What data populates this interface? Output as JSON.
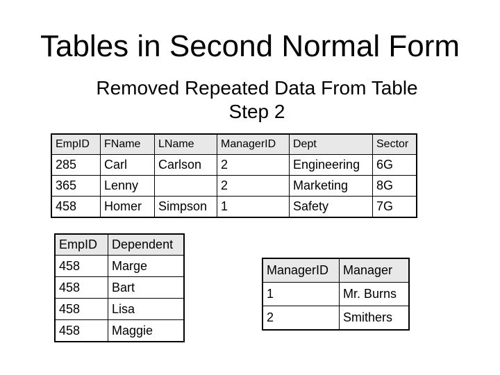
{
  "slide": {
    "title": "Tables in Second Normal Form",
    "subtitle_line1": "Removed Repeated Data From Table",
    "subtitle_line2": "Step 2"
  },
  "employee_table": {
    "headers": [
      "EmpID",
      "FName",
      "LName",
      "ManagerID",
      "Dept",
      "Sector"
    ],
    "rows": [
      [
        "285",
        "Carl",
        "Carlson",
        "2",
        "Engineering",
        "6G"
      ],
      [
        "365",
        "Lenny",
        "",
        "2",
        "Marketing",
        "8G"
      ],
      [
        "458",
        "Homer",
        "Simpson",
        "1",
        "Safety",
        "7G"
      ]
    ]
  },
  "dependent_table": {
    "headers": [
      "EmpID",
      "Dependent"
    ],
    "rows": [
      [
        "458",
        "Marge"
      ],
      [
        "458",
        "Bart"
      ],
      [
        "458",
        "Lisa"
      ],
      [
        "458",
        "Maggie"
      ]
    ]
  },
  "manager_table": {
    "headers": [
      "ManagerID",
      "Manager"
    ],
    "rows": [
      [
        "1",
        "Mr. Burns"
      ],
      [
        "2",
        "Smithers"
      ]
    ]
  },
  "colors": {
    "header_bg": "#e8e8e8",
    "border": "#000000",
    "background": "#ffffff"
  }
}
